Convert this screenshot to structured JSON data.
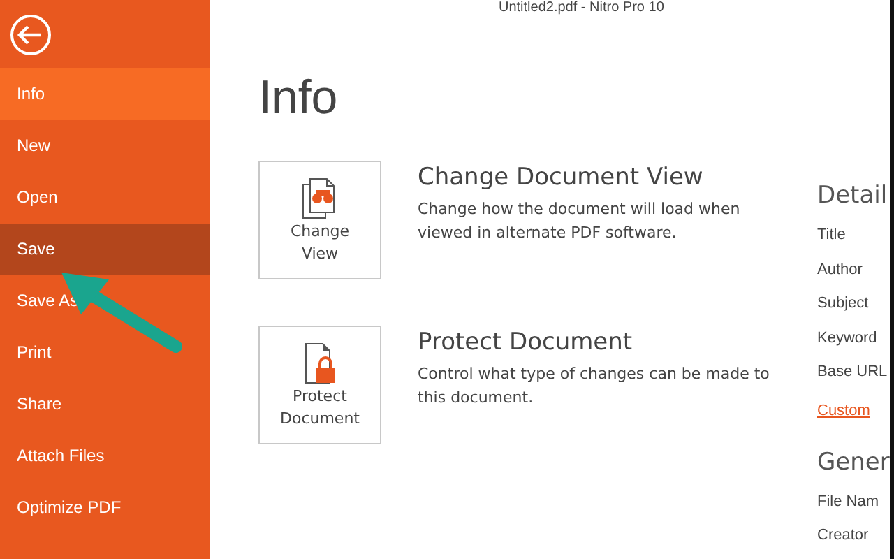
{
  "window": {
    "title": "Untitled2.pdf - Nitro Pro 10"
  },
  "sidebar": {
    "items": [
      {
        "label": "Info",
        "selected": true,
        "hovered": false
      },
      {
        "label": "New",
        "selected": false,
        "hovered": false
      },
      {
        "label": "Open",
        "selected": false,
        "hovered": false
      },
      {
        "label": "Save",
        "selected": false,
        "hovered": true
      },
      {
        "label": "Save As",
        "selected": false,
        "hovered": false
      },
      {
        "label": "Print",
        "selected": false,
        "hovered": false
      },
      {
        "label": "Share",
        "selected": false,
        "hovered": false
      },
      {
        "label": "Attach Files",
        "selected": false,
        "hovered": false
      },
      {
        "label": "Optimize PDF",
        "selected": false,
        "hovered": false
      }
    ]
  },
  "page_title": "Info",
  "actions": [
    {
      "kind": "view",
      "button_lines": [
        "Change",
        "View"
      ],
      "heading": "Change Document View",
      "description": "Change how the document will load when viewed in alternate PDF software."
    },
    {
      "kind": "protect",
      "button_lines": [
        "Protect",
        "Document"
      ],
      "heading": "Protect Document",
      "description": "Control what type of changes can be made to this document."
    }
  ],
  "details": {
    "heading": "Detail",
    "fields": [
      "Title",
      "Author",
      "Subject",
      "Keyword",
      "Base URL"
    ],
    "link": "Custom"
  },
  "general": {
    "heading": "Gener",
    "fields": [
      "File Nam",
      "Creator"
    ]
  }
}
